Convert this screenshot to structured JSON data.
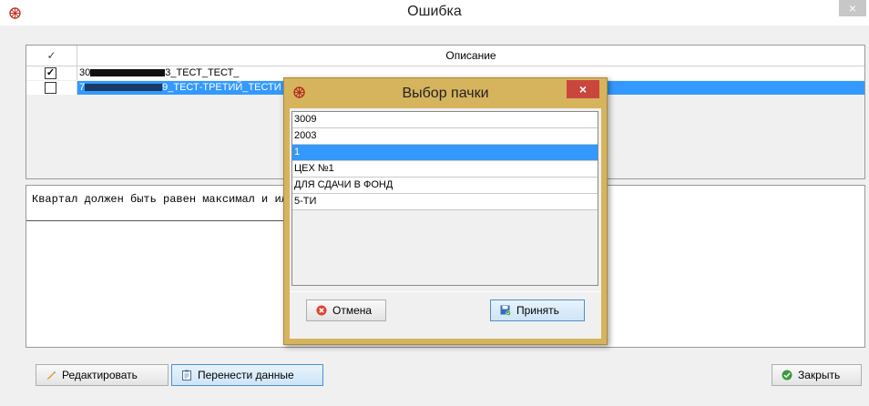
{
  "window": {
    "title": "Ошибка",
    "close": "×"
  },
  "grid": {
    "headers": {
      "check": "✓",
      "description": "Описание"
    },
    "rows": [
      {
        "checked": "✓",
        "prefix": "30",
        "suffix": "3_ТЕСТ_ТЕСТ_"
      },
      {
        "checked": "✓",
        "prefix": "7",
        "suffix": "9_ТЕСТ-ТРЕТИЙ_ТЕСТИ"
      }
    ]
  },
  "error": {
    "message": "Квартал должен быть равен максимал                                         и или периоды по видам деятельности."
  },
  "buttons": {
    "edit": "Редактировать",
    "transfer": "Перенести данные",
    "close": "Закрыть"
  },
  "dialog": {
    "title": "Выбор пачки",
    "close": "×",
    "items": [
      "3009",
      "2003",
      "1",
      "ЦЕХ №1",
      "ДЛЯ СДАЧИ В ФОНД",
      "5-ТИ"
    ],
    "selected_index": 2,
    "cancel": "Отмена",
    "accept": "Принять"
  },
  "colors": {
    "dialog_frame": "#d6b45e",
    "selection": "#3399ff",
    "close_button": "#c9463d"
  }
}
